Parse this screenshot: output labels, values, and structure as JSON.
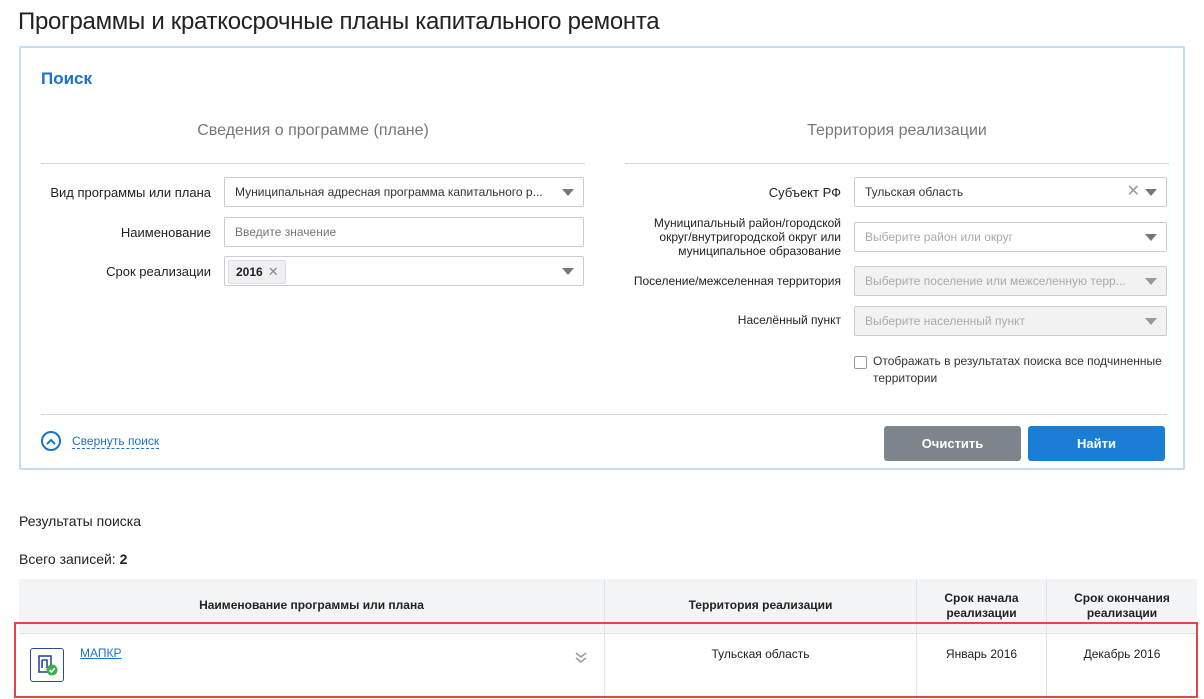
{
  "page": {
    "title": "Программы и краткосрочные планы капитального ремонта"
  },
  "search": {
    "title": "Поиск",
    "left_section_title": "Сведения о программе (плане)",
    "right_section_title": "Территория реализации",
    "program_type": {
      "label": "Вид программы или плана",
      "value": "Муниципальная адресная программа капитального р..."
    },
    "name": {
      "label": "Наименование",
      "placeholder": "Введите значение"
    },
    "term": {
      "label": "Срок реализации",
      "chip": "2016"
    },
    "subject": {
      "label": "Субъект РФ",
      "value": "Тульская область"
    },
    "district": {
      "label_line1": "Муниципальный район/городской",
      "label_line2": "округ/внутригородской округ или",
      "label_line3": "муниципальное образование",
      "placeholder": "Выберите район или округ"
    },
    "settlement": {
      "label": "Поселение/межселенная территория",
      "placeholder": "Выберите поселение или межселенную терр..."
    },
    "locality": {
      "label": "Населённый пункт",
      "placeholder": "Выберите населенный пункт"
    },
    "subordinate": {
      "label_line1": "Отображать в результатах поиска все подчиненные",
      "label_line2": "территории",
      "checked": false
    },
    "collapse_label": "Свернуть поиск",
    "clear_label": "Очистить",
    "find_label": "Найти"
  },
  "results": {
    "title": "Результаты поиска",
    "total_label": "Всего записей:",
    "total_value": "2",
    "columns": [
      {
        "line1": "Наименование программы или плана",
        "line2": ""
      },
      {
        "line1": "Территория реализации",
        "line2": ""
      },
      {
        "line1": "Срок начала",
        "line2": "реализации"
      },
      {
        "line1": "Срок окончания",
        "line2": "реализации"
      }
    ],
    "rows": [
      {
        "name": "МАПКР",
        "territory": "Тульская область",
        "start": "Январь 2016",
        "end": "Декабрь 2016"
      }
    ]
  },
  "colors": {
    "accent": "#1a73c8",
    "highlight": "#e04848",
    "clear_button": "#7d848b",
    "find_button": "#1a7fd4"
  }
}
